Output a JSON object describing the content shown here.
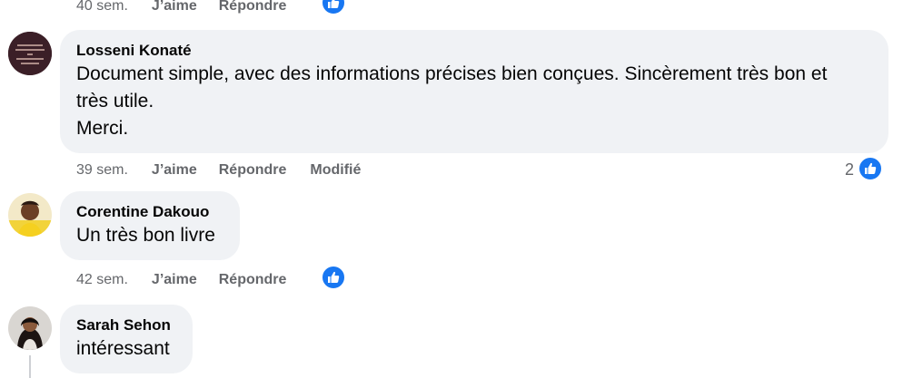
{
  "colors": {
    "bubble_bg": "#f0f2f5",
    "meta_text": "#65676b",
    "like_blue": "#1877f2"
  },
  "top_meta": {
    "time": "40 sem.",
    "like": "J’aime",
    "reply": "Répondre",
    "reaction_icon": "thumbs-up-icon"
  },
  "comments": [
    {
      "author": "Losseni Konaté",
      "lines": [
        "Document simple, avec des informations précises bien conçues. Sincèrement très bon et",
        "très utile.",
        "Merci."
      ],
      "time": "39 sem.",
      "like": "J’aime",
      "reply": "Répondre",
      "edited": "Modifié",
      "reaction_count": "2",
      "reaction_icon": "thumbs-up-icon",
      "avatar": "text-image-avatar"
    },
    {
      "author": "Corentine Dakouo",
      "lines": [
        "Un très bon livre"
      ],
      "time": "42 sem.",
      "like": "J’aime",
      "reply": "Répondre",
      "reaction_icon": "thumbs-up-icon",
      "avatar": "profile-photo-avatar"
    },
    {
      "author": "Sarah Sehon",
      "lines": [
        "intéressant"
      ],
      "avatar": "profile-photo-avatar"
    }
  ]
}
